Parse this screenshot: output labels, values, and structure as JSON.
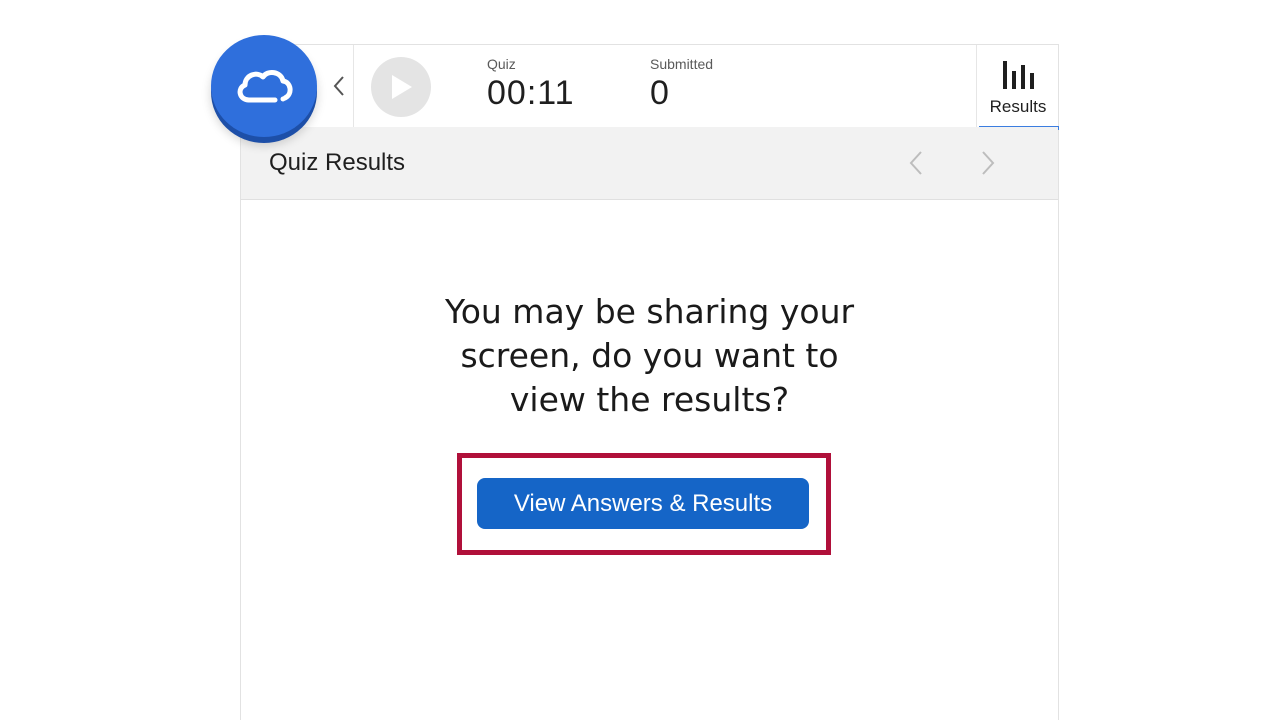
{
  "brand": {
    "logo_icon": "cloud-icon",
    "color": "#2f6fdc"
  },
  "toolbar": {
    "collapse_icon": "chevron-left-icon",
    "play_icon": "play-icon",
    "stats": [
      {
        "label": "Quiz",
        "value": "00:11"
      },
      {
        "label": "Submitted",
        "value": "0"
      }
    ],
    "results_tab": {
      "label": "Results",
      "icon": "bar-chart-icon",
      "active": true,
      "accent": "#3b7de0"
    }
  },
  "header": {
    "title": "Quiz Results",
    "prev_icon": "chevron-left-icon",
    "next_icon": "chevron-right-icon"
  },
  "main": {
    "message_lines": [
      "You may be sharing your",
      "screen, do you want to",
      "view the results?"
    ],
    "view_button_label": "View Answers & Results",
    "button_color": "#1565c7",
    "highlight_color": "#b0103a"
  }
}
